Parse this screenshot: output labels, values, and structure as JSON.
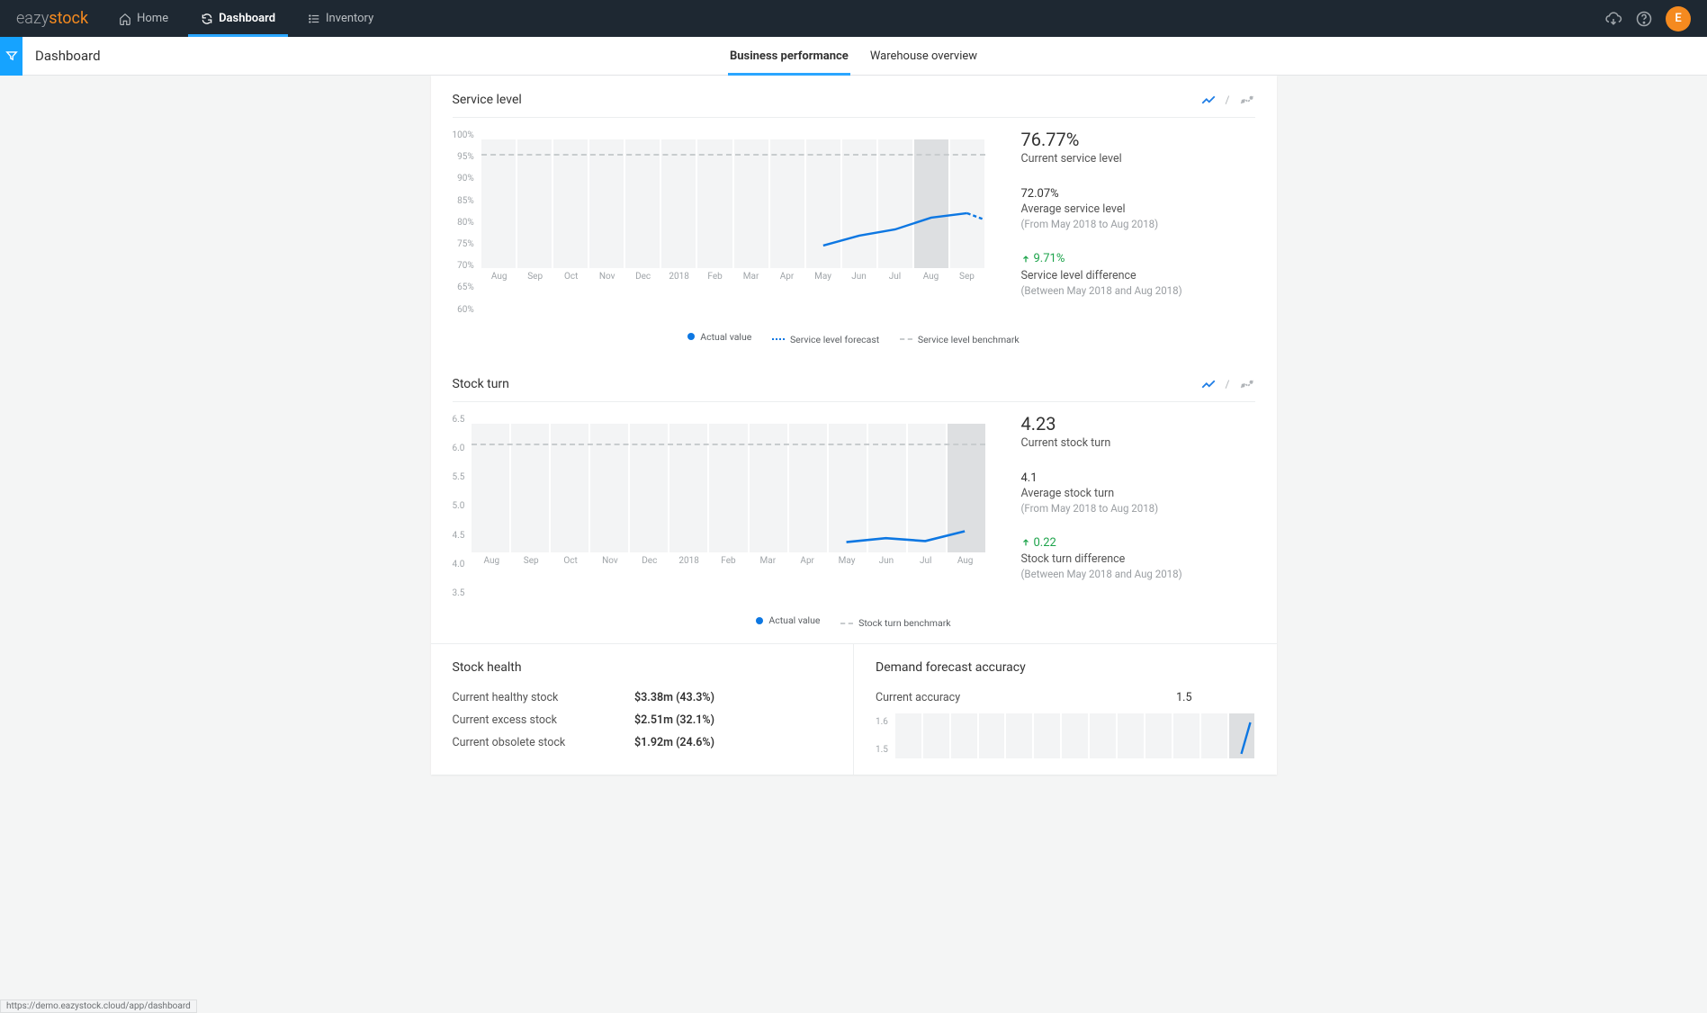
{
  "brand": {
    "left": "eazy",
    "right": "stock"
  },
  "nav": {
    "home": "Home",
    "dashboard": "Dashboard",
    "inventory": "Inventory"
  },
  "avatar_initial": "E",
  "page": {
    "title": "Dashboard",
    "tab_business": "Business performance",
    "tab_warehouse": "Warehouse overview"
  },
  "status_url": "https://demo.eazystock.cloud/app/dashboard",
  "service_level": {
    "title": "Service level",
    "kpi_current": {
      "value": "76.77%",
      "label": "Current service level"
    },
    "kpi_avg": {
      "value": "72.07%",
      "label": "Average service level",
      "note": "(From May 2018 to Aug 2018)"
    },
    "kpi_diff": {
      "value": "9.71%",
      "label": "Service level difference",
      "note": "(Between May 2018 and Aug 2018)"
    },
    "legend": [
      "Actual value",
      "Service level forecast",
      "Service level benchmark"
    ]
  },
  "stock_turn": {
    "title": "Stock turn",
    "kpi_current": {
      "value": "4.23",
      "label": "Current stock turn"
    },
    "kpi_avg": {
      "value": "4.1",
      "label": "Average stock turn",
      "note": "(From May 2018 to Aug 2018)"
    },
    "kpi_diff": {
      "value": "0.22",
      "label": "Stock turn difference",
      "note": "(Between May 2018 and Aug 2018)"
    },
    "legend": [
      "Actual value",
      "Stock turn benchmark"
    ]
  },
  "stock_health": {
    "title": "Stock health",
    "rows": [
      {
        "label": "Current healthy stock",
        "value": "$3.38m (43.3%)"
      },
      {
        "label": "Current excess stock",
        "value": "$2.51m (32.1%)"
      },
      {
        "label": "Current obsolete stock",
        "value": "$1.92m (24.6%)"
      }
    ]
  },
  "forecast": {
    "title": "Demand forecast accuracy",
    "row": {
      "label": "Current accuracy",
      "value": "1.5"
    }
  },
  "chart_data": [
    {
      "type": "line",
      "title": "Service level",
      "categories": [
        "Aug",
        "Sep",
        "Oct",
        "Nov",
        "Dec",
        "2018",
        "Feb",
        "Mar",
        "Apr",
        "May",
        "Jun",
        "Jul",
        "Aug",
        "Sep"
      ],
      "yticks": [
        "100%",
        "95%",
        "90%",
        "85%",
        "80%",
        "75%",
        "70%",
        "65%",
        "60%"
      ],
      "ylim": [
        60,
        100
      ],
      "benchmark": 95,
      "series": [
        {
          "name": "Actual value",
          "start_index": 9,
          "values": [
            67,
            70,
            72,
            75.5,
            76.8
          ]
        },
        {
          "name": "Service level forecast",
          "start_index": 12,
          "values": [
            76.8,
            73.0
          ]
        }
      ]
    },
    {
      "type": "line",
      "title": "Stock turn",
      "categories": [
        "Aug",
        "Sep",
        "Oct",
        "Nov",
        "Dec",
        "2018",
        "Feb",
        "Mar",
        "Apr",
        "May",
        "Jun",
        "Jul",
        "Aug"
      ],
      "yticks": [
        "6.5",
        "6.0",
        "5.5",
        "5.0",
        "4.5",
        "4.0",
        "3.5"
      ],
      "ylim": [
        3.5,
        6.5
      ],
      "benchmark": 6.0,
      "series": [
        {
          "name": "Actual value",
          "start_index": 9,
          "values": [
            4.0,
            4.1,
            4.05,
            4.23
          ]
        }
      ]
    },
    {
      "type": "line",
      "title": "Demand forecast accuracy",
      "yticks": [
        "1.6",
        "1.5"
      ],
      "ylim": [
        1.4,
        1.6
      ],
      "categories": [
        "Aug",
        "Sep",
        "Oct",
        "Nov",
        "Dec",
        "2018",
        "Feb",
        "Mar",
        "Apr",
        "May",
        "Jun",
        "Jul",
        "Aug"
      ],
      "series": [
        {
          "name": "Actual value",
          "start_index": 12,
          "values": [
            1.5
          ]
        }
      ]
    }
  ]
}
